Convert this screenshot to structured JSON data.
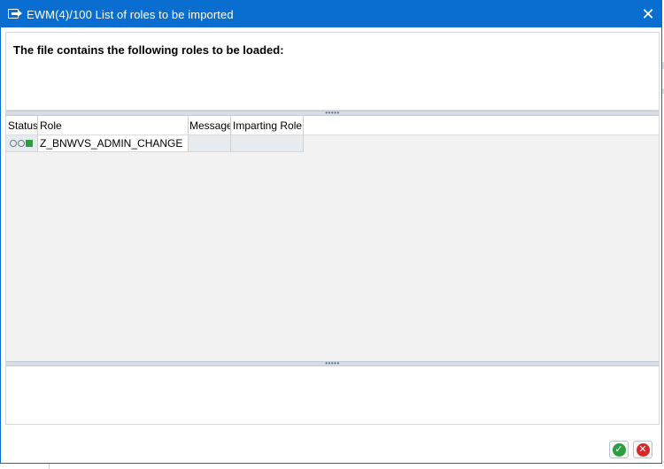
{
  "window": {
    "title": "EWM(4)/100 List of roles to be imported"
  },
  "message": {
    "heading": "The file contains the following roles to be loaded:"
  },
  "grid": {
    "columns": [
      "Status",
      "Role",
      "Message",
      "Imparting Role"
    ],
    "rows": [
      {
        "status_icon": "traffic-light-green-icon",
        "role": "Z_BNWVS_ADMIN_CHANGE",
        "message": "",
        "imparting_role": ""
      }
    ]
  },
  "splitter": {
    "dots": "•••••"
  },
  "footer": {
    "ok_icon": "check-icon",
    "cancel_icon": "cancel-icon",
    "ok_glyph": "✓",
    "cancel_glyph": "✕"
  },
  "colors": {
    "titlebar": "#0a6ed1",
    "status_green": "#2b9e3f",
    "cancel_red": "#d62828"
  }
}
